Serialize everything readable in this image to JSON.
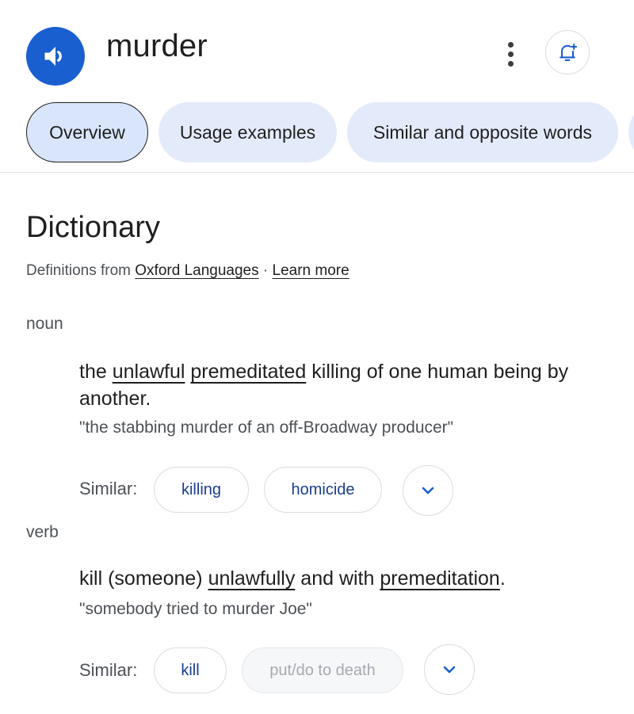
{
  "header": {
    "word": "murder",
    "speaker_icon": "volume-icon",
    "more_icon": "more-vert-icon",
    "alert_icon": "add-alert-icon"
  },
  "tabs": [
    {
      "label": "Overview",
      "active": true
    },
    {
      "label": "Usage examples",
      "active": false
    },
    {
      "label": "Similar and opposite words",
      "active": false
    }
  ],
  "dictionary": {
    "heading": "Dictionary",
    "source_prefix": "Definitions from ",
    "source_link": "Oxford Languages",
    "separator": " · ",
    "learn_more": "Learn more"
  },
  "noun": {
    "pos": "noun",
    "def_parts": [
      "the ",
      "unlawful",
      " ",
      "premeditated",
      " killing of one human being by another."
    ],
    "example": "\"the stabbing murder of an off-Broadway producer\"",
    "similar_label": "Similar:",
    "chips": [
      "killing",
      "homicide"
    ]
  },
  "verb": {
    "pos": "verb",
    "def_parts": [
      "kill (someone) ",
      "unlawfully",
      " and with ",
      "premeditation",
      "."
    ],
    "example": "\"somebody tried to murder Joe\"",
    "similar_label": "Similar:",
    "chips": [
      "kill",
      "put/do to death"
    ]
  },
  "colors": {
    "accent": "#1a5fd0",
    "tab_bg": "#e3ebfb",
    "chip_text": "#1a3d8f"
  }
}
